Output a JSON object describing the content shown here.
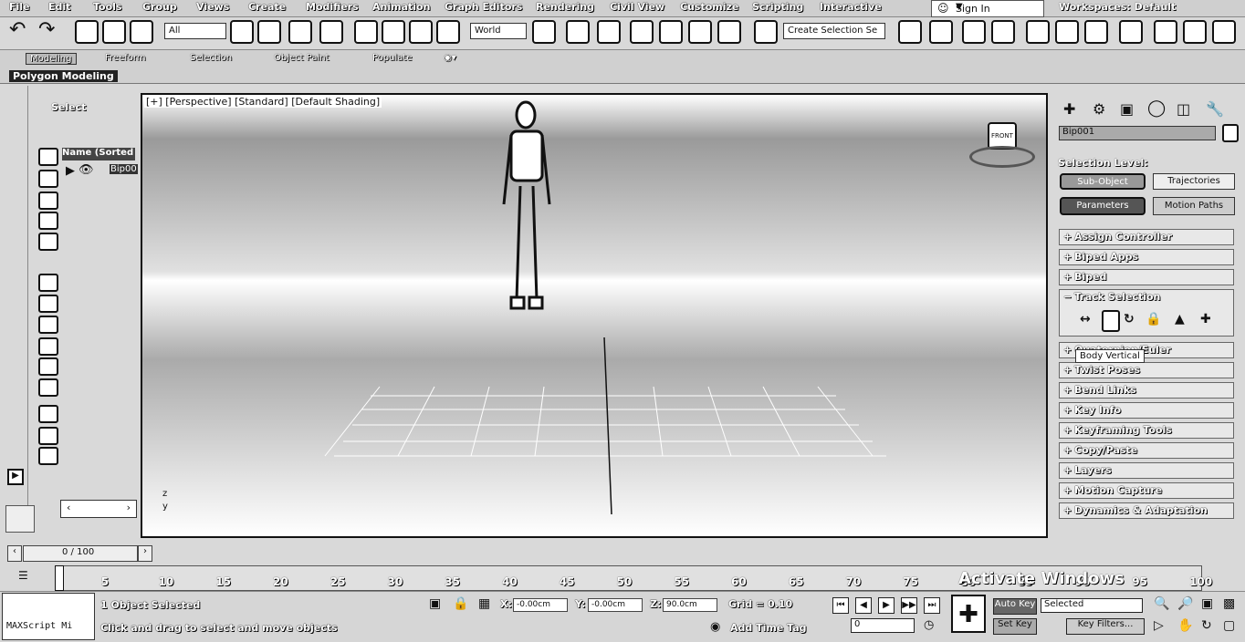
{
  "menu": [
    "File",
    "Edit",
    "Tools",
    "Group",
    "Views",
    "Create",
    "Modifiers",
    "Animation",
    "Graph Editors",
    "Rendering",
    "Civil View",
    "Customize",
    "Scripting",
    "Interactive"
  ],
  "signin": "Sign In",
  "workspaces": {
    "label": "Workspaces:",
    "value": "Default"
  },
  "toolbar": {
    "filter_value": "All",
    "ref_coord": "World",
    "selection_set": "Create Selection Se"
  },
  "ribbon": {
    "tabs": [
      "Modeling",
      "Freeform",
      "Selection",
      "Object Paint",
      "Populate"
    ],
    "active_panel": "Polygon Modeling"
  },
  "scene_explorer": {
    "select_label": "Select",
    "column_header": "Name (Sorted A",
    "item": "Bip00"
  },
  "viewport": {
    "label": "[+] [Perspective] [Standard] [Default Shading]",
    "viewcube_face": "FRONT",
    "axis_z": "z",
    "axis_y": "y"
  },
  "cmdpanel": {
    "object_name": "Bip001",
    "selection_level": "Selection Level:",
    "sub_object": "Sub-Object",
    "trajectories": "Trajectories",
    "parameters": "Parameters",
    "motion_paths": "Motion Paths",
    "rollouts": [
      "Assign Controller",
      "Biped Apps",
      "Biped",
      "Track Selection",
      "Quaternion/Euler",
      "Twist Poses",
      "Bend Links",
      "Key Info",
      "Keyframing Tools",
      "Copy/Paste",
      "Layers",
      "Motion Capture",
      "Dynamics & Adaptation"
    ],
    "tooltip": "Body Vertical"
  },
  "timeline": {
    "slider": "0 / 100",
    "ticks": [
      "5",
      "10",
      "15",
      "20",
      "25",
      "30",
      "35",
      "40",
      "45",
      "50",
      "55",
      "60",
      "65",
      "70",
      "75",
      "80",
      "85",
      "90",
      "95",
      "100"
    ],
    "watermark": "Activate Windows"
  },
  "status": {
    "maxscript": "MAXScript Mi",
    "selected": "1 Object Selected",
    "prompt": "Click and drag to select and move objects",
    "x": "-0.00cm",
    "y": "-0.00cm",
    "z": "90.0cm",
    "grid": "Grid = 0.10",
    "add_time_tag": "Add Time Tag",
    "auto_key": "Auto Key",
    "selected_set": "Selected",
    "set_key": "Set Key",
    "key_filters": "Key Filters...",
    "frame": "0"
  }
}
